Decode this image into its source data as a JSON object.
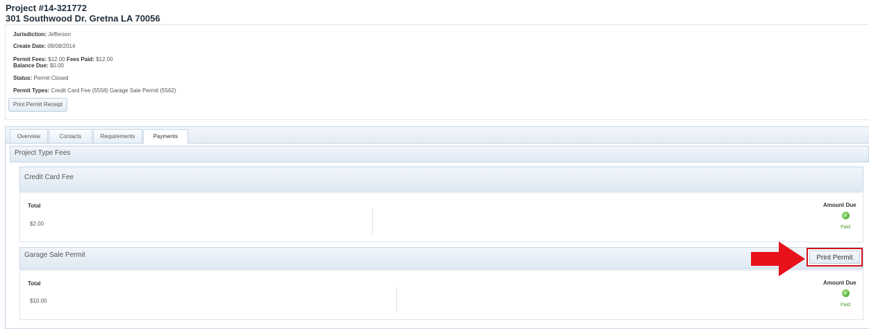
{
  "project": {
    "number": "Project #14-321772",
    "address": "301 Southwood Dr. Gretna LA 70056"
  },
  "info": {
    "jurisdiction_label": "Jurisdiction:",
    "jurisdiction": "Jefferson",
    "create_date_label": "Create Date:",
    "create_date": "08/08/2014",
    "permit_fees_label": "Permit Fees:",
    "permit_fees": "$12.00",
    "fees_paid_label": "Fees Paid:",
    "fees_paid": "$12.00",
    "balance_due_label": "Balance Due:",
    "balance_due": "$0.00",
    "status_label": "Status:",
    "status": "Permit Closed",
    "permit_types_label": "Permit Types:",
    "permit_types": "Credit Card Fee (5558)  Garage Sale Permit (5562)",
    "print_receipt_button": "Print Permit Receipt"
  },
  "tabs": [
    {
      "label": "Overview"
    },
    {
      "label": "Contacts"
    },
    {
      "label": "Requirements"
    },
    {
      "label": "Payments"
    }
  ],
  "active_tab": "Payments",
  "payments": {
    "section_title": "Project Type Fees",
    "fees": [
      {
        "name": "Credit Card Fee",
        "total_label": "Total",
        "total": "$2.00",
        "amount_due_label": "Amount Due",
        "status": "Paid",
        "status_icon": "check-circle-icon"
      },
      {
        "name": "Garage Sale Permit",
        "total_label": "Total",
        "total": "$10.00",
        "amount_due_label": "Amount Due",
        "status": "Paid",
        "status_icon": "check-circle-icon",
        "action_button": "Print Permit"
      }
    ]
  },
  "colors": {
    "highlight_red": "#d4101a",
    "paid_green": "#4a9a2c",
    "header_blue": "#dfe9f3"
  }
}
